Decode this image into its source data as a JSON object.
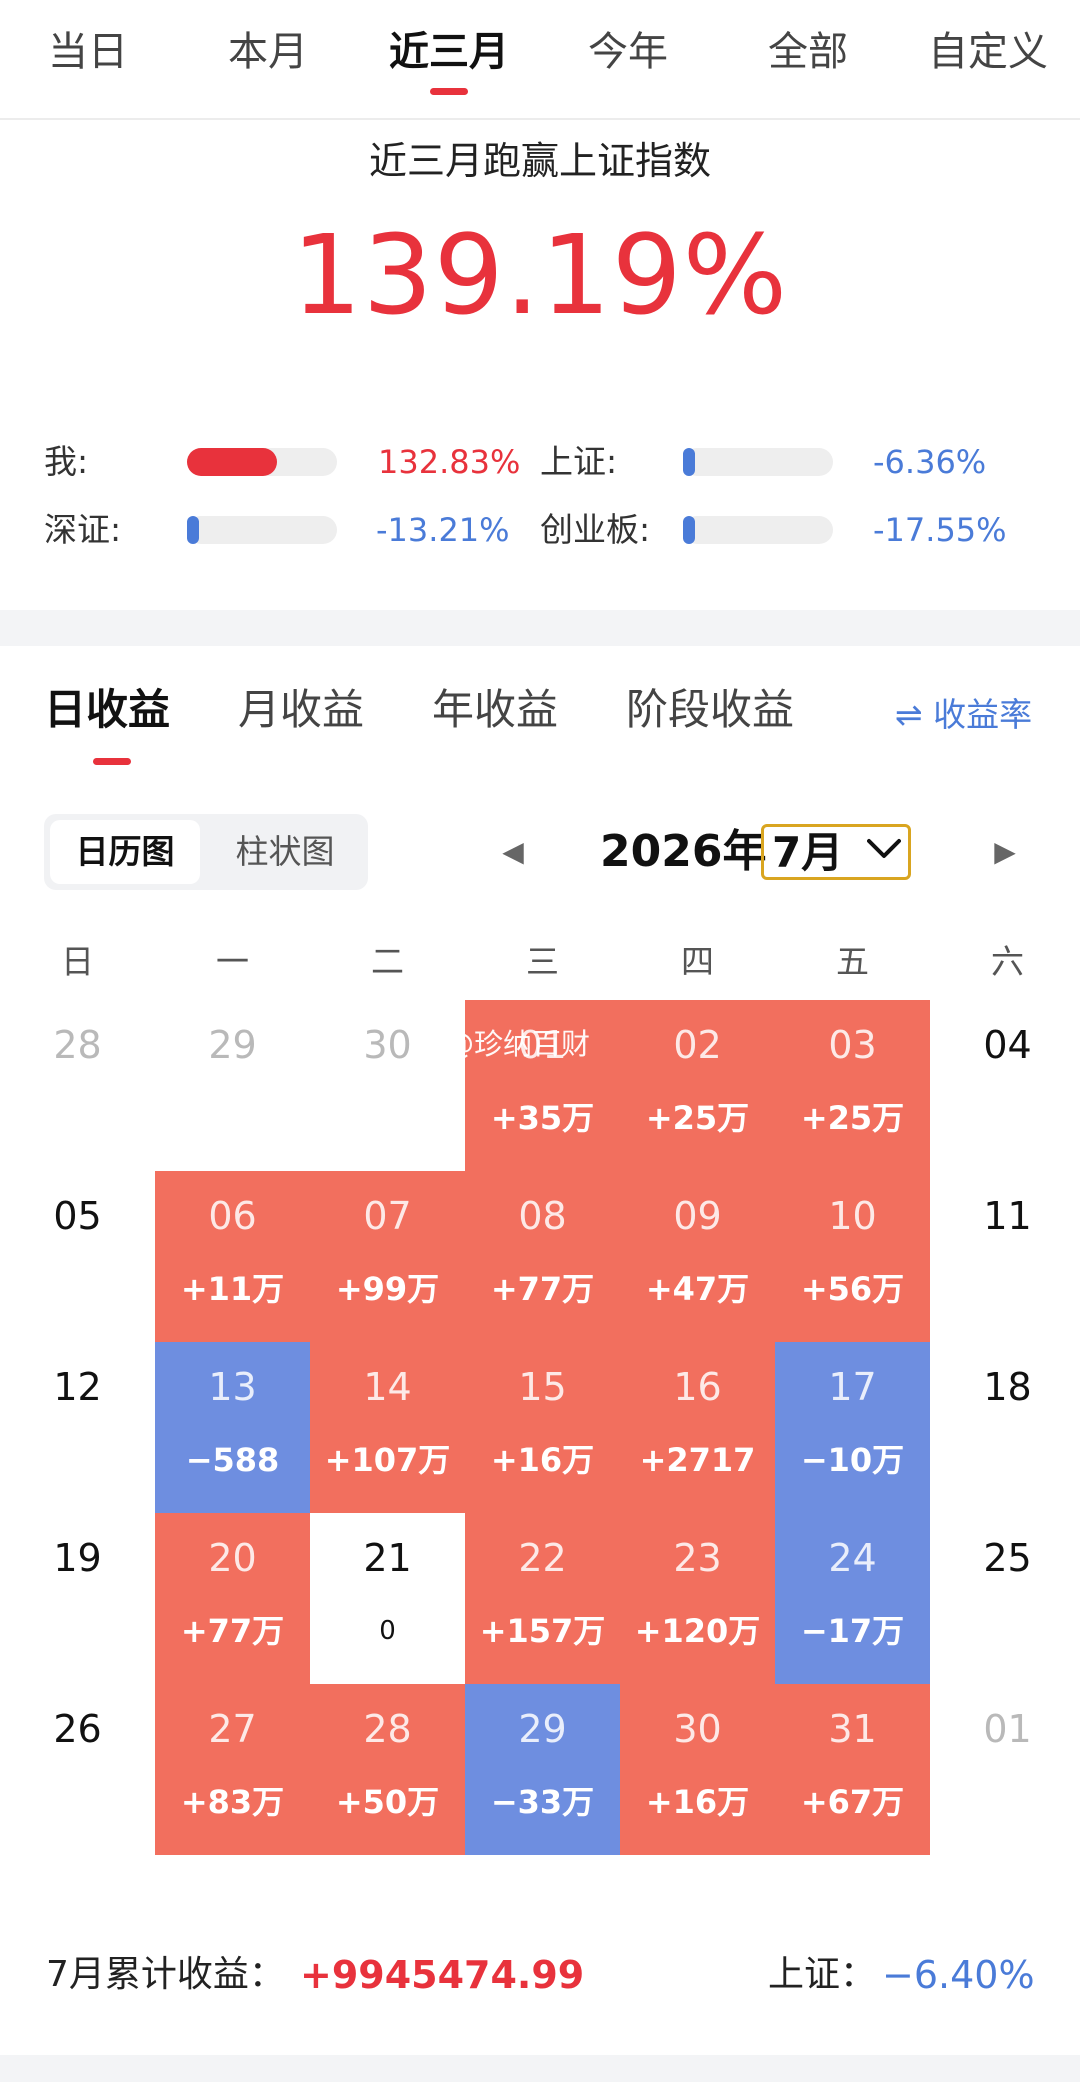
{
  "period_tabs": {
    "items": [
      "当日",
      "本月",
      "近三月",
      "今年",
      "全部",
      "自定义"
    ],
    "active_index": 2
  },
  "summary": {
    "title": "近三月跑赢上证指数",
    "value": "139.19%",
    "comparisons": [
      {
        "label": "我:",
        "value": "132.83%",
        "level": 0.6,
        "color": "#e8323c"
      },
      {
        "label": "上证:",
        "value": "-6.36%",
        "level": 0.03,
        "color": "#4a7bd8"
      },
      {
        "label": "深证:",
        "value": "-13.21%",
        "level": 0.06,
        "color": "#4a7bd8"
      },
      {
        "label": "创业板:",
        "value": "-17.55%",
        "level": 0.08,
        "color": "#4a7bd8"
      }
    ]
  },
  "earnings_tabs": {
    "items": [
      "日收益",
      "月收益",
      "年收益",
      "阶段收益"
    ],
    "active_index": 0,
    "rate_link": "⇌ 收益率"
  },
  "view_toggle": {
    "calendar": "日历图",
    "bar": "柱状图",
    "active": "calendar"
  },
  "month_nav": {
    "year": "2026年",
    "month": "7月",
    "prev_icon": "◀",
    "next_icon": "▶"
  },
  "calendar": {
    "weekdays": [
      "日",
      "一",
      "二",
      "三",
      "四",
      "五",
      "六"
    ],
    "watermark": "@珍纳百财",
    "colors": {
      "gain": "#f26f5e",
      "loss": "#6e8ee0",
      "flat": "#ffffff"
    },
    "cells": [
      {
        "day": "28",
        "value": "",
        "kind": "muted"
      },
      {
        "day": "29",
        "value": "",
        "kind": "muted"
      },
      {
        "day": "30",
        "value": "",
        "kind": "muted"
      },
      {
        "day": "01",
        "value": "+35万",
        "kind": "red"
      },
      {
        "day": "02",
        "value": "+25万",
        "kind": "red"
      },
      {
        "day": "03",
        "value": "+25万",
        "kind": "red"
      },
      {
        "day": "04",
        "value": "",
        "kind": "plain"
      },
      {
        "day": "05",
        "value": "",
        "kind": "plain"
      },
      {
        "day": "06",
        "value": "+11万",
        "kind": "red"
      },
      {
        "day": "07",
        "value": "+99万",
        "kind": "red"
      },
      {
        "day": "08",
        "value": "+77万",
        "kind": "red"
      },
      {
        "day": "09",
        "value": "+47万",
        "kind": "red"
      },
      {
        "day": "10",
        "value": "+56万",
        "kind": "red"
      },
      {
        "day": "11",
        "value": "",
        "kind": "plain"
      },
      {
        "day": "12",
        "value": "",
        "kind": "plain"
      },
      {
        "day": "13",
        "value": "−588",
        "kind": "blue"
      },
      {
        "day": "14",
        "value": "+107万",
        "kind": "red"
      },
      {
        "day": "15",
        "value": "+16万",
        "kind": "red"
      },
      {
        "day": "16",
        "value": "+2717",
        "kind": "red"
      },
      {
        "day": "17",
        "value": "−10万",
        "kind": "blue"
      },
      {
        "day": "18",
        "value": "",
        "kind": "plain"
      },
      {
        "day": "19",
        "value": "",
        "kind": "plain"
      },
      {
        "day": "20",
        "value": "+77万",
        "kind": "red"
      },
      {
        "day": "21",
        "value": "0",
        "kind": "white"
      },
      {
        "day": "22",
        "value": "+157万",
        "kind": "red"
      },
      {
        "day": "23",
        "value": "+120万",
        "kind": "red"
      },
      {
        "day": "24",
        "value": "−17万",
        "kind": "blue"
      },
      {
        "day": "25",
        "value": "",
        "kind": "plain"
      },
      {
        "day": "26",
        "value": "",
        "kind": "plain"
      },
      {
        "day": "27",
        "value": "+83万",
        "kind": "red"
      },
      {
        "day": "28",
        "value": "+50万",
        "kind": "red"
      },
      {
        "day": "29",
        "value": "−33万",
        "kind": "blue"
      },
      {
        "day": "30",
        "value": "+16万",
        "kind": "red"
      },
      {
        "day": "31",
        "value": "+67万",
        "kind": "red"
      },
      {
        "day": "01",
        "value": "",
        "kind": "muted"
      }
    ]
  },
  "footer": {
    "label": "7月累计收益：",
    "value": "+9945474.99",
    "index_label": "上证：",
    "index_value": "−6.40%"
  }
}
